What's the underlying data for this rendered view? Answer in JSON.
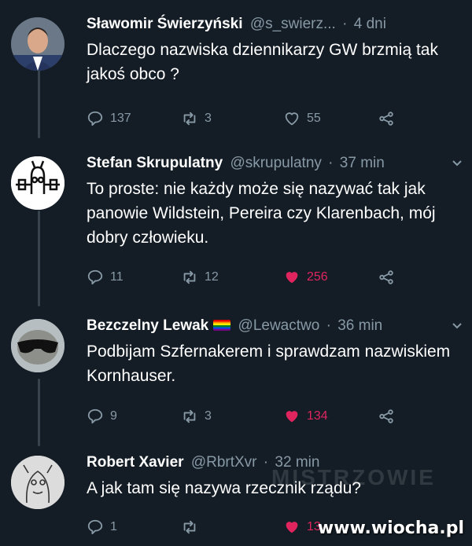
{
  "tweets": [
    {
      "name": "Sławomir Świerzyński",
      "handle": "@s_swierz...",
      "time": "4 dni",
      "text": "Dlaczego nazwiska dziennikarzy GW brzmią tak jakoś obco ?",
      "replies": "137",
      "retweets": "3",
      "likes": "55",
      "liked": false
    },
    {
      "name": "Stefan Skrupulatny",
      "handle": "@skrupulatny",
      "time": "37 min",
      "text": "To proste: nie każdy może się nazywać tak jak panowie Wildstein, Pereira czy Klarenbach, mój dobry człowieku.",
      "replies": "11",
      "retweets": "12",
      "likes": "256",
      "liked": true
    },
    {
      "name": "Bezczelny Lewak",
      "handle": "@Lewactwo",
      "time": "36 min",
      "text": "Podbijam Szfernakerem i sprawdzam nazwiskiem Kornhauser.",
      "replies": "9",
      "retweets": "3",
      "likes": "134",
      "liked": true
    },
    {
      "name": "Robert Xavier",
      "handle": "@RbrtXvr",
      "time": "32 min",
      "text": "A jak tam się nazywa rzecznik rządu?",
      "replies": "1",
      "retweets": "",
      "likes": "13",
      "liked": true
    }
  ],
  "dot": "·",
  "watermark": "www.wiocha.pl",
  "ghost_watermark": "MISTRZOWIE",
  "colors": {
    "background": "#141d26",
    "like": "#e0245e",
    "muted": "#8899a6"
  }
}
